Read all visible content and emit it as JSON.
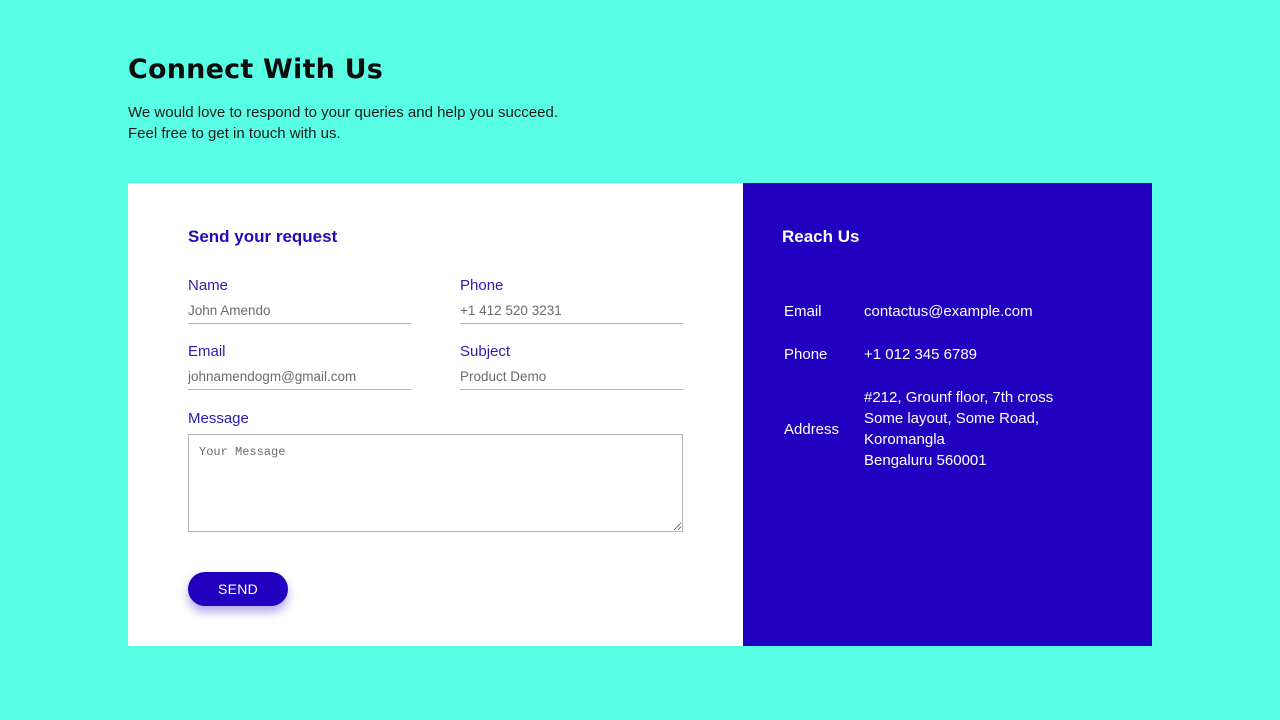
{
  "header": {
    "title": "Connect With Us",
    "intro_lines": [
      "We would love to respond to your queries and help you succeed.",
      "Feel free to get in touch with us."
    ]
  },
  "form": {
    "title": "Send your request",
    "name": {
      "label": "Name",
      "placeholder": "John Amendo"
    },
    "phone": {
      "label": "Phone",
      "placeholder": "+1 412 520 3231"
    },
    "email": {
      "label": "Email",
      "placeholder": "johnamendogm@gmail.com"
    },
    "subject": {
      "label": "Subject",
      "placeholder": "Product Demo"
    },
    "message": {
      "label": "Message",
      "placeholder": "Your Message"
    },
    "send_label": "SEND"
  },
  "contact": {
    "title": "Reach Us",
    "email": {
      "label": "Email",
      "value": "contactus@example.com"
    },
    "phone": {
      "label": "Phone",
      "value": "+1 012 345 6789"
    },
    "address": {
      "label": "Address",
      "lines": [
        "#212, Grounf floor, 7th cross",
        "Some layout, Some Road,",
        "Koromangla",
        "Bengaluru 560001"
      ]
    }
  },
  "colors": {
    "background": "#59ffe4",
    "accent": "#2100bf",
    "card": "#ffffff"
  }
}
